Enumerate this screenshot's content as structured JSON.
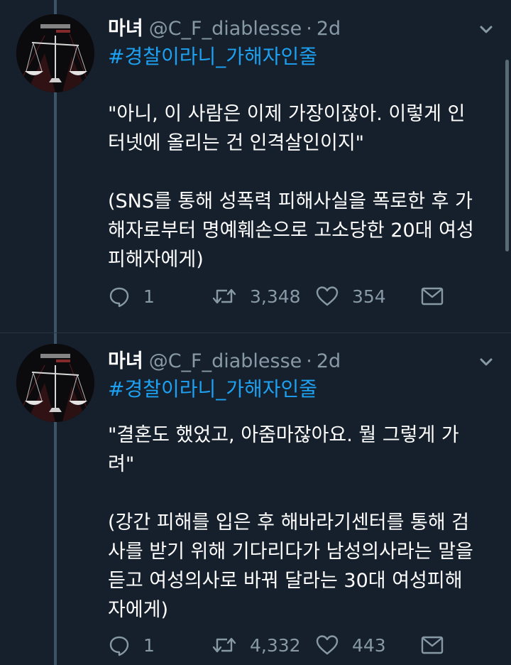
{
  "colors": {
    "background": "#16202c",
    "link": "#1da1f2",
    "muted": "#8899a6",
    "thread_line": "#3d5466"
  },
  "tweets": [
    {
      "name": "마녀",
      "handle": "@C_F_diablesse",
      "separator": "·",
      "time": "2d",
      "hashtag": "#경찰이라니_가해자인줄",
      "lines": [
        "\"아니, 이 사람은 이제 가장이잖아. 이렇게 인",
        "터넷에 올리는 건 인격살인이지\"",
        "",
        "(SNS를 통해 성폭력 피해사실을 폭로한 후 가",
        "해자로부터 명예훼손으로 고소당한 20대 여성",
        "피해자에게)"
      ],
      "replies": "1",
      "retweets": "3,348",
      "likes": "354",
      "icons": [
        "reply-icon",
        "retweet-icon",
        "like-icon",
        "direct-message-icon",
        "chevron-down-icon"
      ]
    },
    {
      "name": "마녀",
      "handle": "@C_F_diablesse",
      "separator": "·",
      "time": "2d",
      "hashtag": "#경찰이라니_가해자인줄",
      "lines": [
        "\"결혼도 했었고, 아줌마잖아요. 뭘 그렇게 가",
        "려\"",
        "",
        "(강간 피해를 입은 후 해바라기센터를 통해 검",
        "사를 받기 위해 기다리다가 남성의사라는 말을",
        "듣고 여성의사로 바꿔 달라는 30대 여성피해",
        "자에게)"
      ],
      "replies": "1",
      "retweets": "4,332",
      "likes": "443",
      "icons": [
        "reply-icon",
        "retweet-icon",
        "like-icon",
        "direct-message-icon",
        "chevron-down-icon"
      ]
    }
  ]
}
